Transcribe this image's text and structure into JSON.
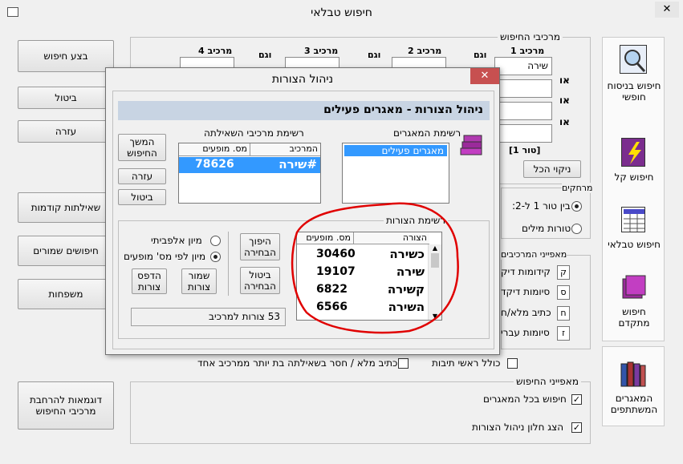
{
  "window": {
    "title": "חיפוש טבלאי"
  },
  "left_buttons": {
    "search": "בצע חיפוש",
    "cancel": "ביטול",
    "help": "עזרה",
    "previous": "שאילתות קודמות",
    "saved": "חיפושים שמורים",
    "families": "משפחות",
    "examples": "דוגמאות להרחבת מרכיבי החיפוש"
  },
  "components": {
    "group_label": "מרכיבי החיפוש",
    "headers": [
      "מרכיב 1",
      "מרכיב 2",
      "מרכיב 3",
      "מרכיב 4"
    ],
    "and_label": "וגם",
    "or_label": "או",
    "first_value": "שירה",
    "row_label": "[טור 1]",
    "clear_all": "ניקוי הכל"
  },
  "distance": {
    "label": "מרחקים",
    "between": "בין טור 1 ל-2:",
    "words": "טורות מילים"
  },
  "characteristics": {
    "label": "מאפייני המרכיבים",
    "keys": [
      "ק",
      "ס",
      "ח",
      "ז"
    ],
    "prefixes": "קידומות דיק",
    "suffixes": "סיומות דיקד",
    "spelling": "כתיב מלא/ח",
    "hebrew": "סיומות עברי"
  },
  "bottom_checks": {
    "acronyms": "כולל ראשי תיבות",
    "full_spelling": "כתיב מלא / חסר בשאילתה בת יותר ממרכיב אחד"
  },
  "search_features": {
    "label": "מאפייני החיפוש",
    "all_db": "חיפוש בכל המאגרים",
    "show_window": "הצג חלון ניהול הצורות"
  },
  "side": {
    "free": "חיפוש בניסוח חופשי",
    "easy": "חיפוש קל",
    "tabular": "חיפוש טבלאי",
    "advanced": "חיפוש מתקדם",
    "shared": "המאגרים המשתתפים"
  },
  "dialog": {
    "title": "ניהול הצורות",
    "header": "ניהול הצורות - מאגרים פעילים",
    "db_list_label": "רשימת המאגרים",
    "db_item": "מאגרים פעילים",
    "query_list_label": "רשימת מרכיבי השאילתה",
    "query_cols": [
      "המרכיב",
      "מס. מופעים"
    ],
    "query_row": {
      "term": "#שירה",
      "count": "78626"
    },
    "continue_btn": "המשך החיפוש",
    "help_btn": "עזרה",
    "cancel_btn": "ביטול",
    "forms_label": "רשימת הצורות",
    "forms_cols": [
      "הצורה",
      "מס. מופעים"
    ],
    "forms": [
      {
        "form": "כשירה",
        "count": "30460"
      },
      {
        "form": "שירה",
        "count": "19107"
      },
      {
        "form": "קשירה",
        "count": "6822"
      },
      {
        "form": "השירה",
        "count": "6566"
      },
      {
        "form": "",
        "count": ""
      }
    ],
    "invert_btn": "היפוך הבחירה",
    "cancel_sel_btn": "ביטול הבחירה",
    "save_btn": "שמור צורות",
    "print_btn": "הדפס צורות",
    "sort_alpha": "מיון אלפביתי",
    "sort_count": "מיון לפי מס' מופעים",
    "status": "53 צורות למרכיב"
  },
  "colors": {
    "accent": "#3399ff",
    "close_red": "#c75050",
    "annotation": "#e00000"
  }
}
